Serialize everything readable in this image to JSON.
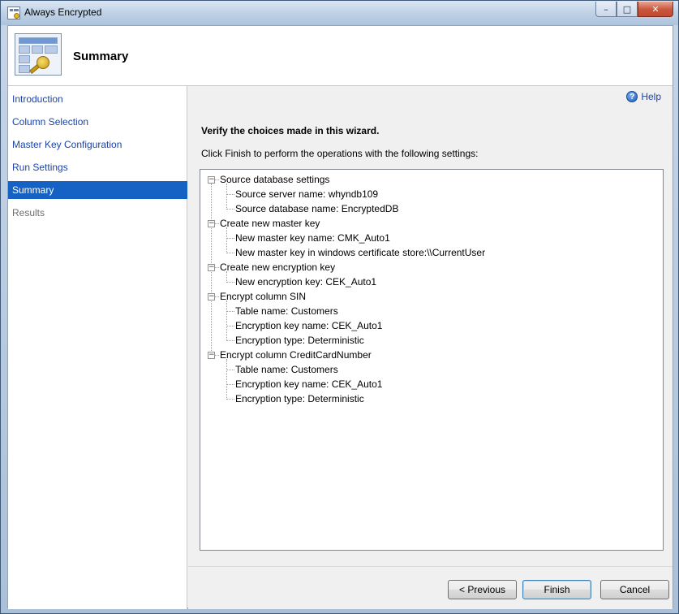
{
  "window": {
    "title": "Always Encrypted"
  },
  "caption_buttons": {
    "minimize": "–",
    "maximize": "□",
    "close": "✕"
  },
  "header": {
    "title": "Summary",
    "icon": "key-table-icon"
  },
  "nav": {
    "items": [
      {
        "label": "Introduction",
        "state": "normal"
      },
      {
        "label": "Column Selection",
        "state": "normal"
      },
      {
        "label": "Master Key Configuration",
        "state": "normal"
      },
      {
        "label": "Run Settings",
        "state": "normal"
      },
      {
        "label": "Summary",
        "state": "selected"
      },
      {
        "label": "Results",
        "state": "disabled"
      }
    ]
  },
  "main": {
    "help_label": "Help",
    "heading": "Verify the choices made in this wizard.",
    "instruction": "Click Finish to perform the operations with the following settings:",
    "tree": [
      {
        "label": "Source database settings",
        "children": [
          "Source server name: whyndb109",
          "Source database name: EncryptedDB"
        ]
      },
      {
        "label": "Create new master key",
        "children": [
          "New master key name: CMK_Auto1",
          "New master key in windows certificate store:\\\\CurrentUser"
        ]
      },
      {
        "label": "Create new encryption key",
        "children": [
          "New encryption key: CEK_Auto1"
        ]
      },
      {
        "label": "Encrypt column SIN",
        "children": [
          "Table name: Customers",
          "Encryption key name: CEK_Auto1",
          "Encryption type: Deterministic"
        ]
      },
      {
        "label": "Encrypt column CreditCardNumber",
        "children": [
          "Table name: Customers",
          "Encryption key name: CEK_Auto1",
          "Encryption type: Deterministic"
        ]
      }
    ]
  },
  "buttons": {
    "previous": "< Previous",
    "finish": "Finish",
    "cancel": "Cancel"
  },
  "colors": {
    "selected_nav": "#1662c4",
    "link": "#1c43a8"
  }
}
